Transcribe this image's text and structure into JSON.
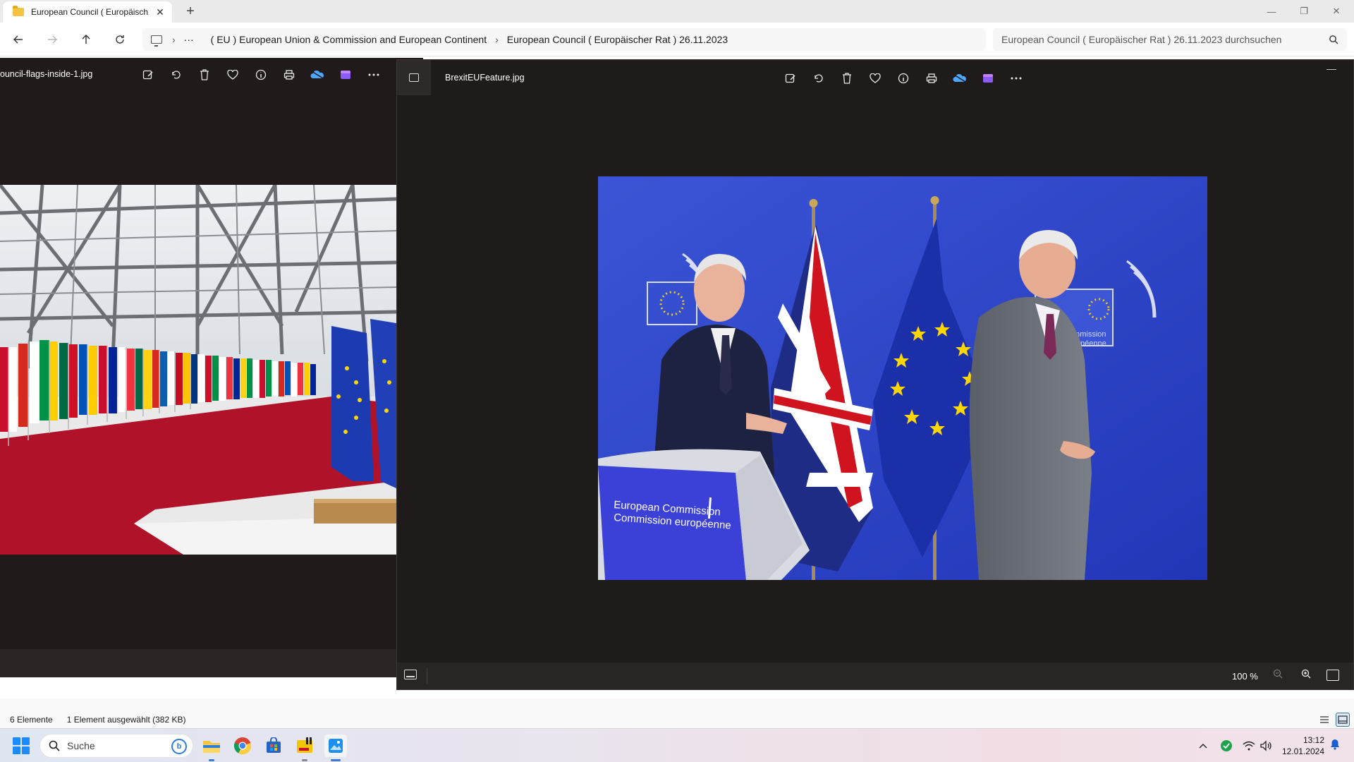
{
  "explorer": {
    "tab_title": "European Council ( Europäisch",
    "tab_close": "✕",
    "tab_add": "+",
    "window_controls": {
      "minimize": "—",
      "restore": "❐",
      "close": "✕"
    },
    "breadcrumb": {
      "overflow": "···",
      "items": [
        "( EU ) European Union & Commission and European Continent",
        "European Council ( Europäischer Rat ) 26.11.2023"
      ]
    },
    "search_placeholder": "European Council ( Europäischer Rat ) 26.11.2023 durchsuchen",
    "status": {
      "count": "6 Elemente",
      "selection": "1 Element ausgewählt (382 KB)"
    }
  },
  "photos_back": {
    "filename": "ouncil-flags-inside-1.jpg"
  },
  "photos_front": {
    "filename": "BrexitEUFeature.jpg",
    "zoom": "100 %",
    "podium_text_line1": "European Commission",
    "podium_text_line2": "Commission européenne",
    "backdrop_text_1": "Commission",
    "backdrop_text_2": "européenne"
  },
  "taskbar": {
    "search_placeholder": "Suche",
    "time": "13:12",
    "date": "12.01.2024"
  },
  "colors": {
    "accent": "#1a8cff",
    "photo_bg": "#201b1b",
    "eu_blue": "#2a44c9",
    "carpet_red": "#b0122a"
  }
}
